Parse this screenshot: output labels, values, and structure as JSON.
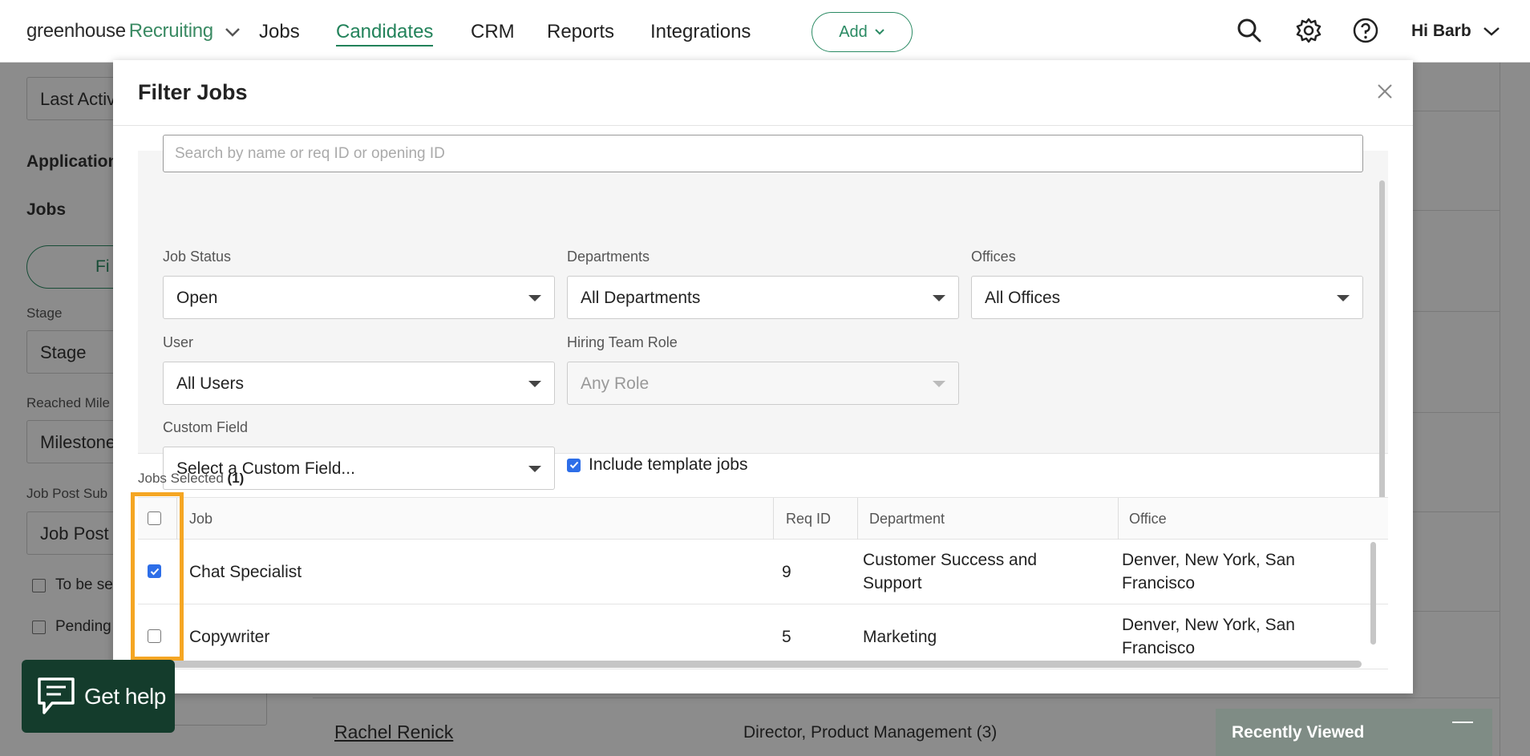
{
  "topnav": {
    "logo_main": "greenhouse",
    "logo_product": "Recruiting",
    "links": [
      "Jobs",
      "Candidates",
      "CRM",
      "Reports",
      "Integrations"
    ],
    "add_label": "Add",
    "greeting": "Hi Barb"
  },
  "background": {
    "sort_value": "Last Activ",
    "applications_heading": "Application",
    "jobs_heading": "Jobs",
    "filter_pill": "Fi",
    "stage_label": "Stage",
    "stage_value": "Stage",
    "milestone_label": "Reached Mile",
    "milestone_value": "Milestone",
    "jobpost_label": "Job Post Sub",
    "jobpost_value": "Job Post",
    "check_1": "To be se",
    "check_2": "Pending",
    "candidate_name": "Rachel Renick",
    "candidate_role": "Director, Product Management (3)",
    "recently_viewed": "Recently Viewed"
  },
  "help": {
    "label": "Get help"
  },
  "modal": {
    "title": "Filter Jobs",
    "search_placeholder": "Search by name or req ID or opening ID",
    "job_status_label": "Job Status",
    "job_status_value": "Open",
    "departments_label": "Departments",
    "departments_value": "All Departments",
    "offices_label": "Offices",
    "offices_value": "All Offices",
    "user_label": "User",
    "user_value": "All Users",
    "hiring_role_label": "Hiring Team Role",
    "hiring_role_value": "Any Role",
    "custom_field_label": "Custom Field",
    "custom_field_value": "Select a Custom Field...",
    "include_template_label": "Include template jobs",
    "include_template_checked": true,
    "jobs_selected_label": "Jobs Selected",
    "jobs_selected_count": "(1)",
    "columns": [
      "Job",
      "Req ID",
      "Department",
      "Office"
    ],
    "rows": [
      {
        "job": "Chat Specialist",
        "req": "9",
        "dept_line1": "Customer Success and",
        "dept_line2": "Support",
        "office_line1": "Denver, New York, San",
        "office_line2": "Francisco",
        "checked": true
      },
      {
        "job": "Copywriter",
        "req": "5",
        "dept_line1": "Marketing",
        "dept_line2": "",
        "office_line1": "Denver, New York, San",
        "office_line2": "Francisco",
        "checked": false
      }
    ]
  },
  "colors": {
    "brand_green": "#22825a",
    "checkbox_blue": "#2d6ee8",
    "highlight_orange": "#f5a623",
    "help_bg": "#143c2c"
  }
}
